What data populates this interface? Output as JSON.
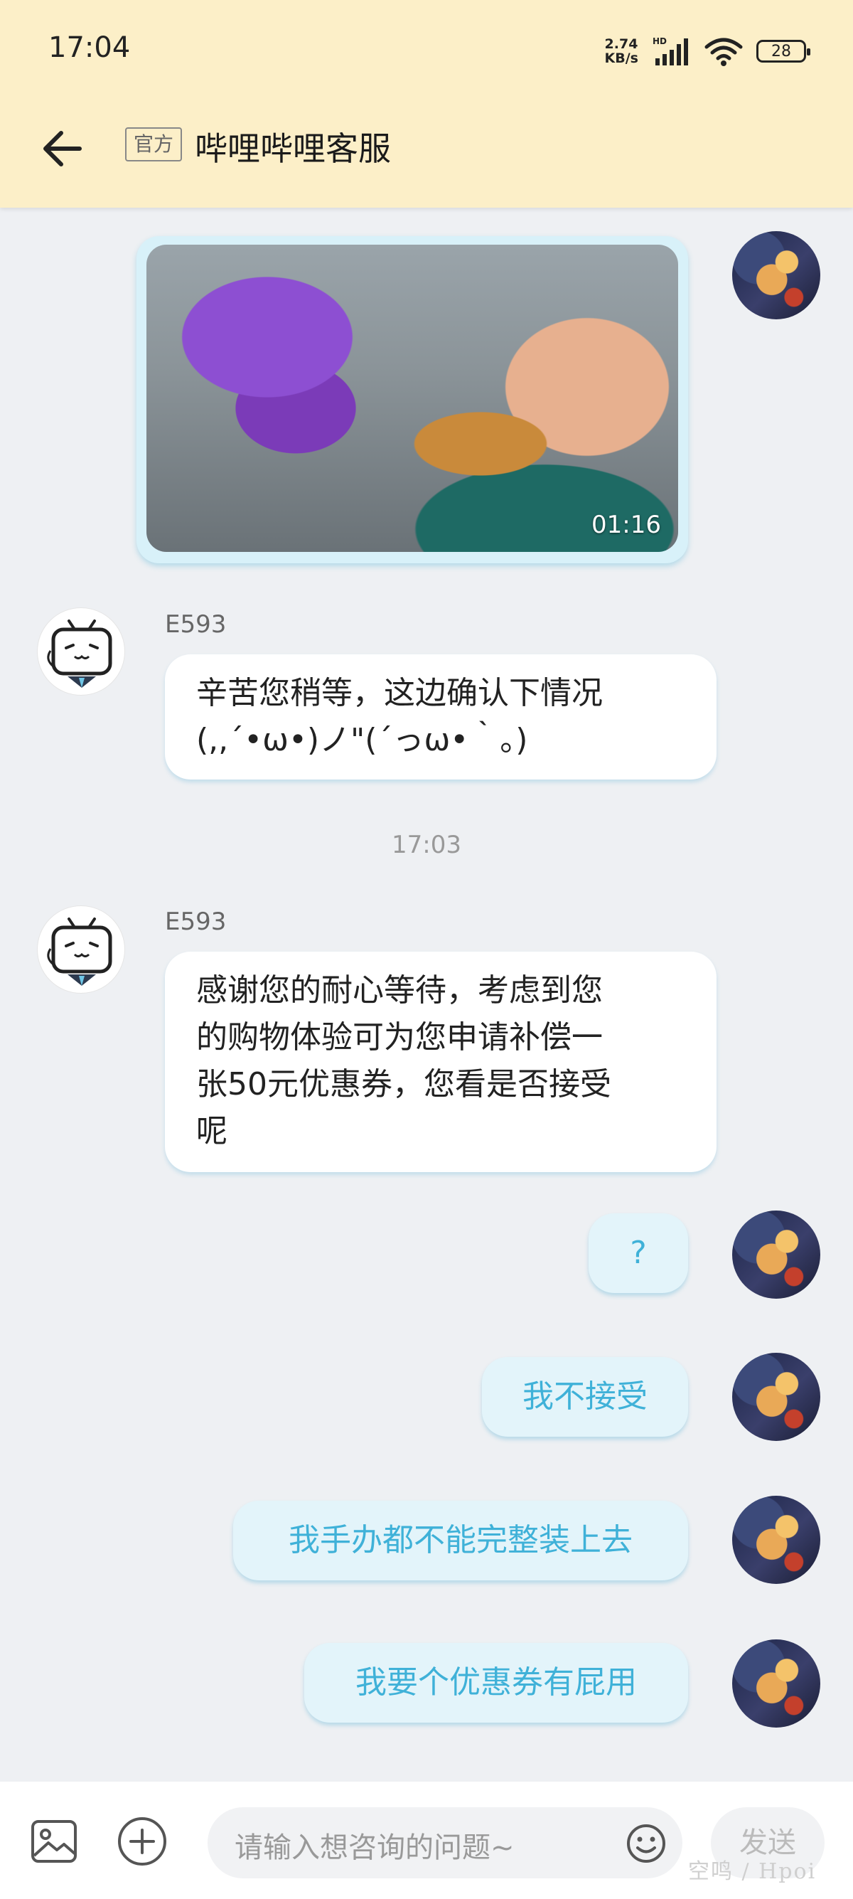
{
  "status_bar": {
    "time": "17:04",
    "net_speed_value": "2.74",
    "net_speed_unit": "KB/s",
    "network_label": "HD",
    "battery": "28"
  },
  "header": {
    "badge": "官方",
    "title": "哔哩哔哩客服"
  },
  "video": {
    "duration": "01:16"
  },
  "messages": [
    {
      "sender": "E593",
      "text_line1": "辛苦您稍等，这边确认下情况",
      "text_line2": "(,,´•ω•)ノ\"(´っω•｀。)"
    },
    {
      "sender": "E593",
      "text_line1": "感谢您的耐心等待，考虑到您",
      "text_line2": "的购物体验可为您申请补偿一",
      "text_line3": "张50元优惠券，您看是否接受",
      "text_line4": "呢"
    }
  ],
  "timestamp": "17:03",
  "user_replies": [
    "?",
    "我不接受",
    "我手办都不能完整装上去",
    "我要个优惠券有屁用"
  ],
  "input_bar": {
    "placeholder": "请输入想咨询的问题~",
    "send_label": "发送"
  },
  "watermark": "空鸣 / Hpoi",
  "colors": {
    "header_bg": "#fcefc8",
    "out_bubble_bg": "#e3f4fa",
    "out_bubble_text": "#3fb1d8",
    "chat_bg": "#eef0f3"
  }
}
